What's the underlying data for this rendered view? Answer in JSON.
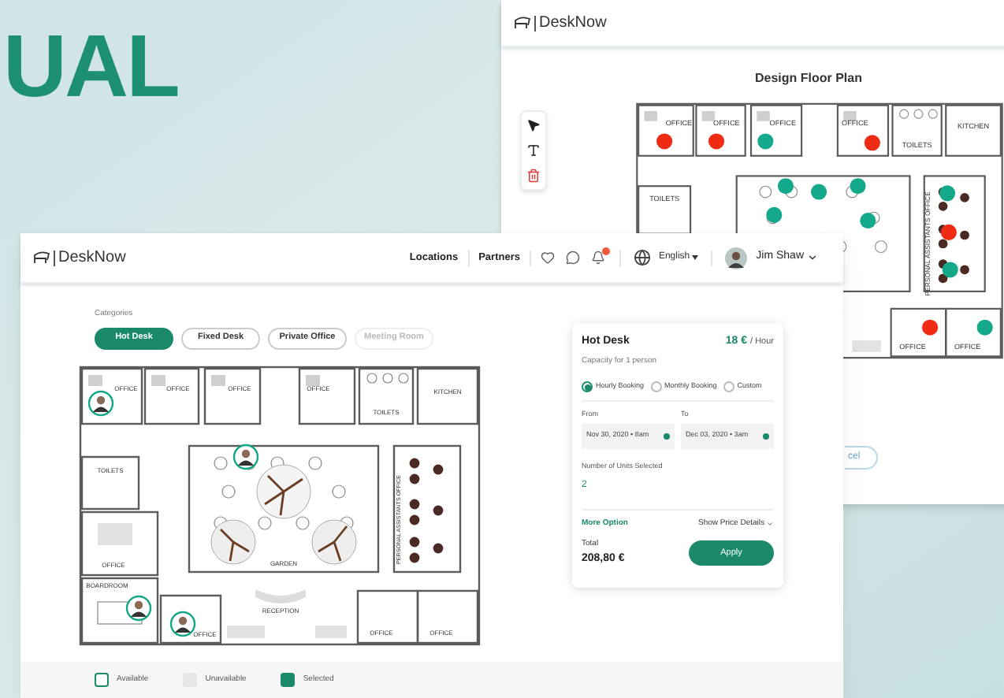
{
  "backdrop": {
    "headline": "UAL"
  },
  "editor": {
    "logo": "DeskNow",
    "title": "Design Floor Plan",
    "cancel_button": "cel",
    "plan": {
      "rooms": [
        {
          "label": "OFFICE"
        },
        {
          "label": "OFFICE"
        },
        {
          "label": "OFFICE"
        },
        {
          "label": "OFFICE"
        },
        {
          "label": "TOILETS"
        },
        {
          "label": "KITCHEN"
        },
        {
          "label": "TOILETS"
        },
        {
          "label": "PERSONAL ASSISTANTS OFFICE"
        },
        {
          "label": "OFFICE"
        },
        {
          "label": "OFFICE"
        }
      ],
      "desks": [
        {
          "color": "#ef2b14"
        },
        {
          "color": "#ef2b14"
        },
        {
          "color": "#13a98a"
        },
        {
          "color": "#ef2b14"
        },
        {
          "color": "#13a98a"
        },
        {
          "color": "#13a98a"
        },
        {
          "color": "#13a98a"
        },
        {
          "color": "#13a98a"
        },
        {
          "color": "#13a98a"
        },
        {
          "color": "#13a98a"
        },
        {
          "color": "#ef2b14"
        },
        {
          "color": "#13a98a"
        },
        {
          "color": "#ef2b14"
        },
        {
          "color": "#13a98a"
        }
      ]
    }
  },
  "app": {
    "logo": "DeskNow",
    "nav": [
      "Locations",
      "Partners"
    ],
    "language": "English",
    "user": "Jim Shaw",
    "categories_label": "Categories",
    "categories": [
      {
        "label": "Hot Desk",
        "selected": true,
        "disabled": false
      },
      {
        "label": "Fixed Desk",
        "selected": false,
        "disabled": false
      },
      {
        "label": "Private Office",
        "selected": false,
        "disabled": false
      },
      {
        "label": "Meeting Room",
        "selected": false,
        "disabled": true
      }
    ],
    "plan": {
      "rooms": [
        {
          "label": "OFFICE"
        },
        {
          "label": "OFFICE"
        },
        {
          "label": "OFFICE"
        },
        {
          "label": "OFFICE"
        },
        {
          "label": "TOILETS"
        },
        {
          "label": "KITCHEN"
        },
        {
          "label": "TOILETS"
        },
        {
          "label": "OFFICE"
        },
        {
          "label": "BOARDROOM"
        },
        {
          "label": "OFFICE"
        },
        {
          "label": "GARDEN"
        },
        {
          "label": "RECEPTION"
        },
        {
          "label": "PERSONAL ASSISTANTS OFFICE"
        },
        {
          "label": "OFFICE"
        },
        {
          "label": "OFFICE"
        }
      ]
    },
    "booking": {
      "title": "Hot Desk",
      "price": "18 €",
      "unit": "/ Hour",
      "capacity": "Capacity for 1 person",
      "options": [
        {
          "label": "Hourly Booking",
          "selected": true
        },
        {
          "label": "Monthly Booking",
          "selected": false
        },
        {
          "label": "Custom",
          "selected": false
        }
      ],
      "from_label": "From",
      "from_value": "Nov 30, 2020 • 8am",
      "to_label": "To",
      "to_value": "Dec 03, 2020 • 3am",
      "units_label": "Number of Units Selected",
      "units_value": "2",
      "more_option": "More Option",
      "price_details": "Show Price Details",
      "total_label": "Total",
      "total_value": "208,80 €",
      "apply": "Apply"
    },
    "legend": [
      {
        "label": "Available",
        "kind": "available"
      },
      {
        "label": "Unavailable",
        "kind": "unavailable"
      },
      {
        "label": "Selected",
        "kind": "selected"
      }
    ]
  }
}
